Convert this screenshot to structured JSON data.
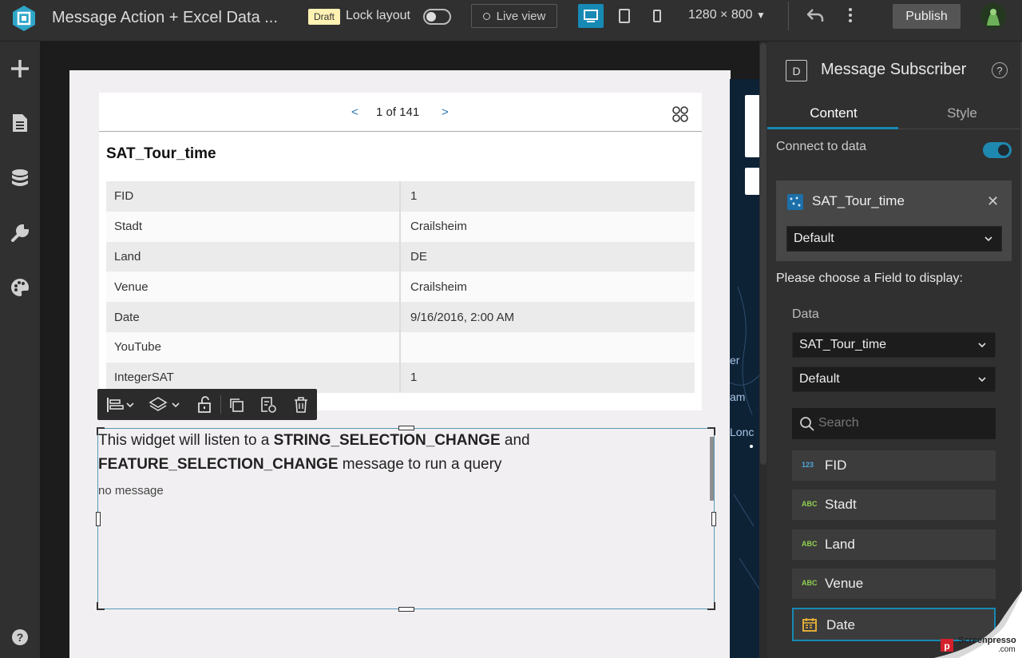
{
  "topbar": {
    "app_title": "Message Action + Excel Data ...",
    "draft_badge": "Draft",
    "lock_layout_label": "Lock layout",
    "live_view_label": "Live view",
    "resolution_label": "1280 × 800",
    "publish_label": "Publish"
  },
  "feature_info": {
    "pager_prev": "<",
    "pager_next": ">",
    "pager_count": "1 of 141",
    "title": "SAT_Tour_time",
    "attributes": [
      {
        "key": "FID",
        "value": "1"
      },
      {
        "key": "Stadt",
        "value": "Crailsheim"
      },
      {
        "key": "Land",
        "value": "DE"
      },
      {
        "key": "Venue",
        "value": "Crailsheim"
      },
      {
        "key": "Date",
        "value": "9/16/2016, 2:00 AM"
      },
      {
        "key": "YouTube",
        "value": ""
      },
      {
        "key": "IntegerSAT",
        "value": "1"
      }
    ]
  },
  "message_widget": {
    "text_1": "This widget will listen to a ",
    "bold_1": "STRING_SELECTION_CHANGE",
    "text_2": " and",
    "bold_2": "FEATURE_SELECTION_CHANGE",
    "text_3": " message to run a query",
    "status": "no message"
  },
  "map_labels": [
    "er",
    "am",
    "Lonc"
  ],
  "right_panel": {
    "header_icon_letter": "D",
    "title": "Message Subscriber",
    "help_glyph": "?",
    "tabs": [
      {
        "label": "Content",
        "active": true
      },
      {
        "label": "Style",
        "active": false
      }
    ],
    "connect_label": "Connect to data",
    "datasource": {
      "name": "SAT_Tour_time",
      "view_select": "Default"
    },
    "choose_field_label": "Please choose a Field to display:",
    "data_label": "Data",
    "data_select": "SAT_Tour_time",
    "view_select": "Default",
    "search_placeholder": "Search",
    "fields": [
      {
        "type": "123",
        "name": "FID"
      },
      {
        "type": "ABC",
        "name": "Stadt"
      },
      {
        "type": "ABC",
        "name": "Land"
      },
      {
        "type": "ABC",
        "name": "Venue"
      },
      {
        "type": "date",
        "name": "Date",
        "selected": true
      }
    ]
  },
  "watermark": {
    "line1": "Screenpresso",
    "line2": ".com"
  },
  "colors": {
    "accent": "#168ab4",
    "topbar_bg": "#303030",
    "page_bg": "#f1eff1",
    "draft_badge": "#fff2b3",
    "number_field_icon": "#4ea6dc",
    "string_field_icon": "#8fd14f",
    "date_field_icon": "#f0b63a"
  }
}
